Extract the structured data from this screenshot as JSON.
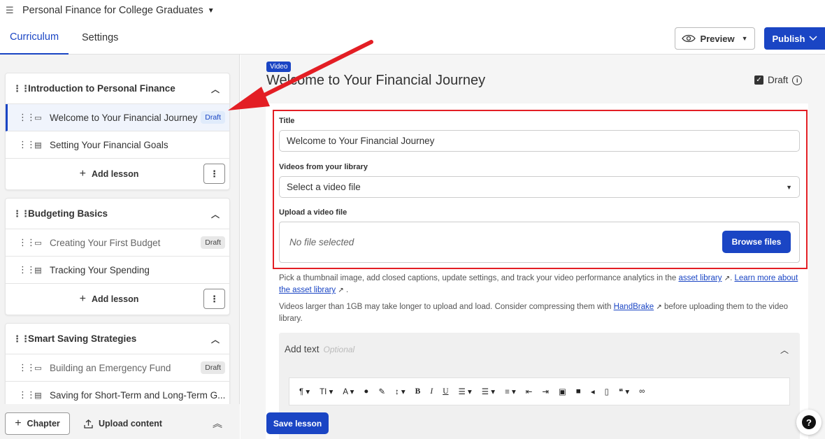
{
  "topbar": {
    "menu_icon": "hamburger-icon",
    "course_title": "Personal Finance for College Graduates"
  },
  "tabs": [
    {
      "label": "Curriculum",
      "active": true
    },
    {
      "label": "Settings",
      "active": false
    }
  ],
  "header_actions": {
    "preview_label": "Preview",
    "publish_label": "Publish"
  },
  "sidebar": {
    "chapters": [
      {
        "title": "Introduction to Personal Finance",
        "lessons": [
          {
            "type": "video",
            "title": "Welcome to Your Financial Journey",
            "badge": "Draft",
            "active": true
          },
          {
            "type": "document",
            "title": "Setting Your Financial Goals",
            "badge": ""
          }
        ],
        "add_lesson": "Add lesson"
      },
      {
        "title": "Budgeting Basics",
        "lessons": [
          {
            "type": "video",
            "title": "Creating Your First Budget",
            "badge": "Draft"
          },
          {
            "type": "document",
            "title": "Tracking Your Spending",
            "badge": ""
          }
        ],
        "add_lesson": "Add lesson"
      },
      {
        "title": "Smart Saving Strategies",
        "lessons": [
          {
            "type": "video",
            "title": "Building an Emergency Fund",
            "badge": "Draft"
          },
          {
            "type": "document",
            "title": "Saving for Short-Term and Long-Term G...",
            "badge": ""
          }
        ]
      }
    ],
    "footer": {
      "chapter_label": "Chapter",
      "upload_label": "Upload content"
    }
  },
  "main": {
    "type_tag": "Video",
    "title": "Welcome to Your Financial Journey",
    "draft_label": "Draft",
    "draft_checked": true,
    "form": {
      "title_label": "Title",
      "title_value": "Welcome to Your Financial Journey",
      "library_label": "Videos from your library",
      "library_value": "Select a video file",
      "upload_label": "Upload a video file",
      "upload_status": "No file selected",
      "browse_label": "Browse files"
    },
    "help1": {
      "text": "Pick a thumbnail image, add closed captions, update settings, and track your video performance analytics in the",
      "link1": "asset library",
      "link2": "Learn more about the asset library"
    },
    "help2": {
      "text": "Videos larger than 1GB may take longer to upload and load. Consider compressing them with",
      "link": "HandBrake",
      "suffix": "before uploading them to the video library."
    },
    "add_text": {
      "label": "Add text",
      "optional": "Optional"
    },
    "save_label": "Save lesson"
  },
  "colors": {
    "accent": "#1a45c4",
    "annotation_red": "#e31e24"
  }
}
